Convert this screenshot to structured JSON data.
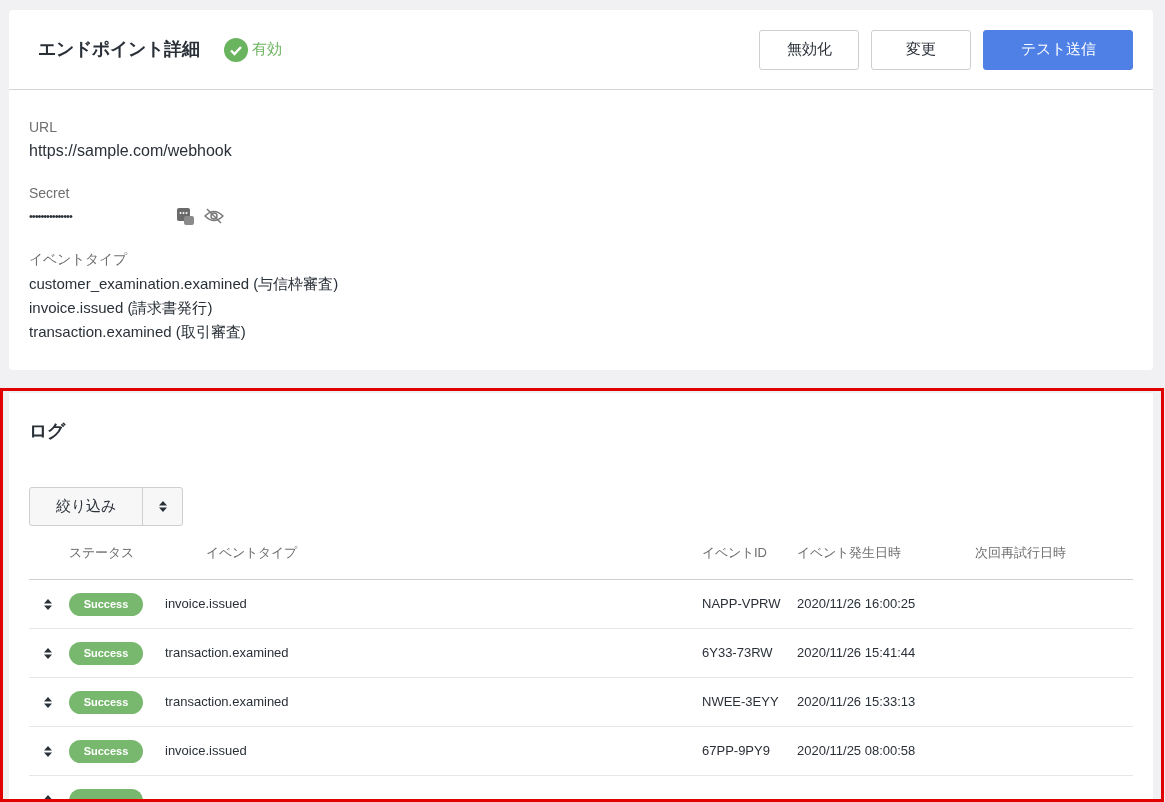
{
  "endpoint": {
    "title": "エンドポイント詳細",
    "status": {
      "label": "有効",
      "enabled": true
    },
    "buttons": [
      {
        "label": "無効化",
        "kind": "secondary"
      },
      {
        "label": "変更",
        "kind": "secondary"
      },
      {
        "label": "テスト送信",
        "kind": "primary"
      }
    ],
    "url": {
      "label": "URL",
      "value": "https://sample.com/webhook"
    },
    "secret": {
      "label": "Secret",
      "value": "•••••••••••••••"
    },
    "event_types": {
      "label": "イベントタイプ",
      "items": [
        "customer_examination.examined (与信枠審査)",
        "invoice.issued (請求書発行)",
        "transaction.examined (取引審査)"
      ]
    }
  },
  "log": {
    "title": "ログ",
    "filter": {
      "label": "絞り込み"
    },
    "columns": [
      "ステータス",
      "イベントタイプ",
      "イベントID",
      "イベント発生日時",
      "次回再試行日時"
    ],
    "rows": [
      {
        "status": "Success",
        "color": "#78b86e",
        "event_type": "invoice.issued",
        "event_id": "NAPP-VPRW",
        "occurred_at": "2020/11/26 16:00:25"
      },
      {
        "status": "Success",
        "color": "#78b86e",
        "event_type": "transaction.examined",
        "event_id": "6Y33-73RW",
        "occurred_at": "2020/11/26 15:41:44"
      },
      {
        "status": "Success",
        "color": "#78b86e",
        "event_type": "transaction.examined",
        "event_id": "NWEE-3EYY",
        "occurred_at": "2020/11/26 15:33:13"
      },
      {
        "status": "Success",
        "color": "#78b86e",
        "event_type": "invoice.issued",
        "event_id": "67PP-9PY9",
        "occurred_at": "2020/11/25 08:00:58"
      }
    ],
    "partial_row_visible": true
  }
}
